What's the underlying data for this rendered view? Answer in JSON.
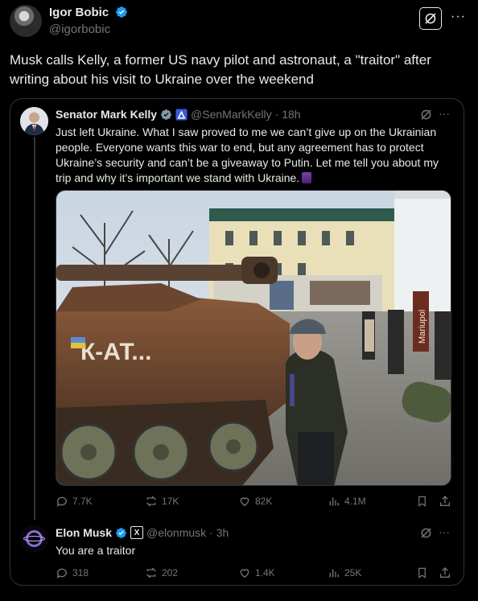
{
  "author": {
    "name": "Igor Bobic",
    "handle": "@igorbobic",
    "text": "Musk calls  Kelly, a former US navy pilot and astronaut, a \"traitor\" after writing about his visit to Ukraine over the weekend"
  },
  "quoted": {
    "name": "Senator Mark Kelly",
    "handle": "@SenMarkKelly",
    "time": "· 18h",
    "text": "Just left Ukraine. What I saw proved to me we can’t give up on the Ukrainian people. Everyone wants this war to end, but any agreement has to protect Ukraine’s security and can’t be a giveaway to Putin. Let me tell you about my trip and why it’s important we stand with Ukraine.",
    "emoji_icon": "scroll-icon",
    "image": {
      "tank_text": "К-АТ...",
      "street_sign": "Mariupol"
    },
    "stats": {
      "replies": "7.7K",
      "reposts": "17K",
      "likes": "82K",
      "views": "4.1M"
    }
  },
  "reply": {
    "name": "Elon Musk",
    "handle": "@elonmusk",
    "time": "· 3h",
    "text": "You are a traitor",
    "stats": {
      "replies": "318",
      "reposts": "202",
      "likes": "1.4K",
      "views": "25K"
    }
  },
  "colors": {
    "verified_blue": "#1d9bf0",
    "gov_badge": "#3b5bdb",
    "muted": "#71767b",
    "border": "#2f3336"
  }
}
